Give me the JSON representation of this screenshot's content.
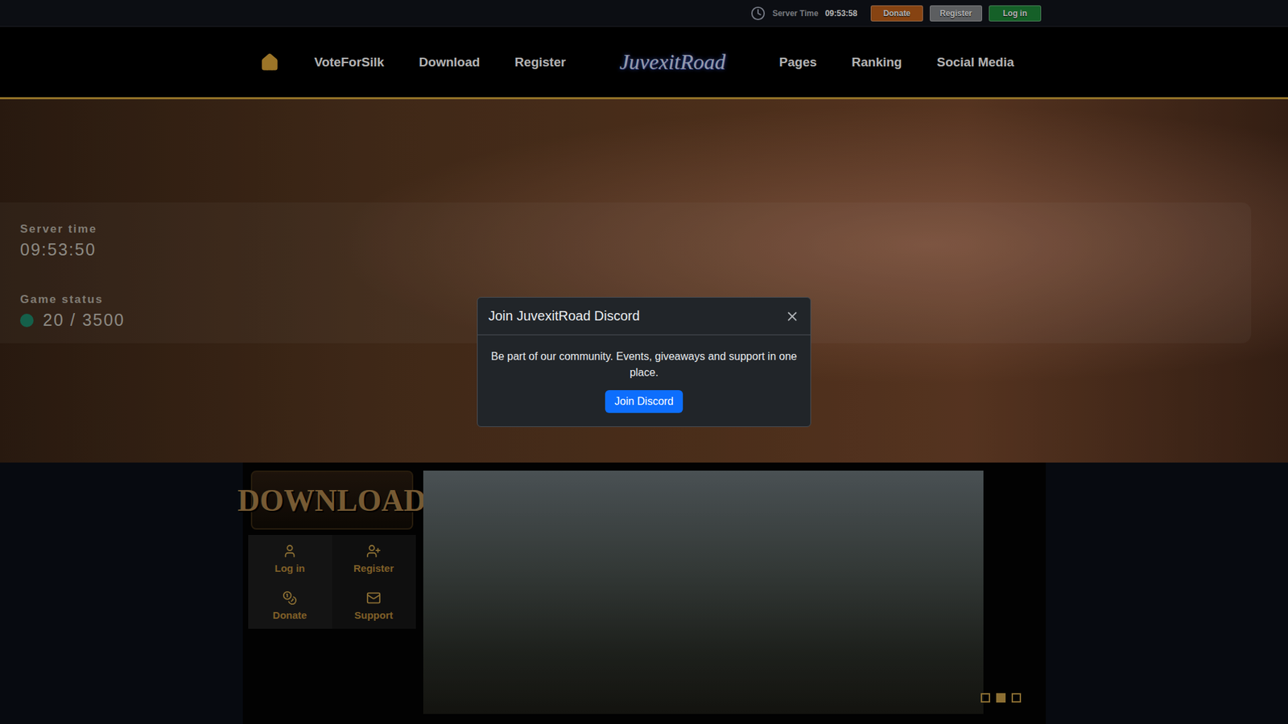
{
  "top_bar": {
    "server_time_label": "Server Time",
    "server_time": "09:53:58",
    "buttons": [
      {
        "label": "Donate",
        "color": "#c0601a"
      },
      {
        "label": "Register",
        "color": "#85878a"
      },
      {
        "label": "Log in",
        "color": "#1f8a3a"
      }
    ]
  },
  "nav": {
    "left": [
      "VoteForSilk",
      "Download",
      "Register"
    ],
    "logo": "JuvexitRoad",
    "right": [
      "Pages",
      "Ranking",
      "Social Media"
    ]
  },
  "status_panel": {
    "server_time_label": "Server time",
    "server_time": "09:53:50",
    "game_status_label": "Game status",
    "online": true,
    "players": "20 / 3500"
  },
  "modal": {
    "title": "Join JuvexitRoad Discord",
    "body": "Be part of our community. Events, giveaways and support in one place.",
    "button": "Join Discord"
  },
  "sidebar": {
    "banner": "DOWNLOAD",
    "items": [
      "Log in",
      "Register",
      "Donate",
      "Support"
    ]
  },
  "slider": {
    "slides": [
      {
        "selected": false
      },
      {
        "selected": true
      },
      {
        "selected": false
      }
    ]
  }
}
